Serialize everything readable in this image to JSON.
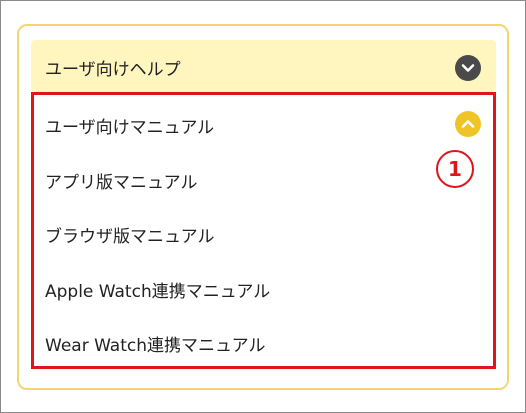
{
  "accordion": {
    "header_label": "ユーザ向けヘルプ",
    "header_icon": "chevron-down-icon",
    "expanded_icon": "chevron-up-icon",
    "items": [
      {
        "label": "ユーザ向けマニュアル"
      },
      {
        "label": "アプリ版マニュアル"
      },
      {
        "label": "ブラウザ版マニュアル"
      },
      {
        "label": "Apple Watch連携マニュアル"
      },
      {
        "label": "Wear Watch連携マニュアル"
      }
    ]
  },
  "annotation": {
    "callout_number": "1"
  },
  "colors": {
    "panel_border": "#f1d774",
    "header_bg": "#fff5bf",
    "header_chevron_bg": "#4a4a4a",
    "item_chevron_bg": "#f0c426",
    "highlight_red": "#e0141b"
  }
}
